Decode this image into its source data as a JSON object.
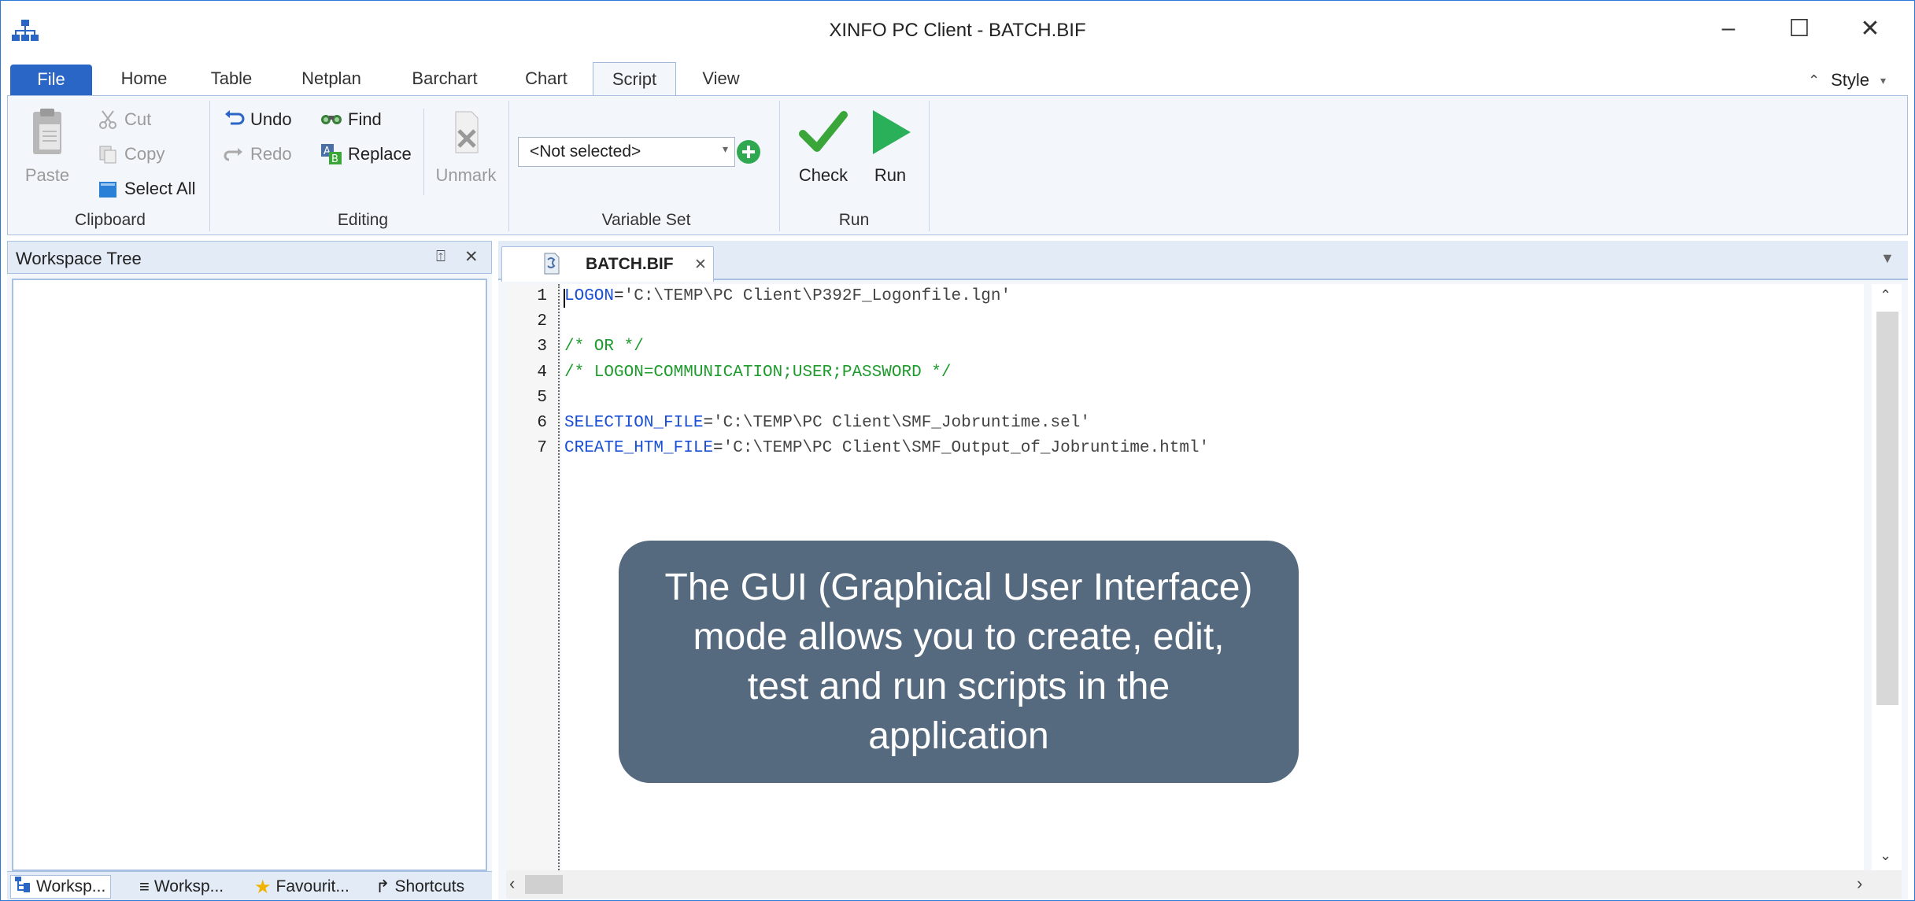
{
  "window": {
    "title": "XINFO PC Client - BATCH.BIF",
    "minimize_glyph": "–",
    "maximize_glyph": "☐",
    "close_glyph": "✕"
  },
  "ribbon_tabs": [
    "File",
    "Home",
    "Table",
    "Netplan",
    "Barchart",
    "Chart",
    "Script",
    "View"
  ],
  "active_tab": "Script",
  "style_menu": "Style",
  "ribbon": {
    "clipboard": {
      "label": "Clipboard",
      "paste": "Paste",
      "cut": "Cut",
      "copy": "Copy",
      "select_all": "Select All"
    },
    "editing": {
      "label": "Editing",
      "undo": "Undo",
      "redo": "Redo",
      "find": "Find",
      "replace": "Replace",
      "unmark": "Unmark"
    },
    "variable_set": {
      "label": "Variable Set",
      "selected": "<Not selected>"
    },
    "run": {
      "label": "Run",
      "check": "Check",
      "run": "Run"
    }
  },
  "workspace": {
    "title": "Workspace Tree",
    "pin_glyph": "⍐",
    "close_glyph": "✕",
    "bottom_tabs": [
      "Worksp...",
      "Worksp...",
      "Favourit...",
      "Shortcuts"
    ]
  },
  "editor": {
    "tab_label": "BATCH.BIF",
    "tab_close": "✕",
    "lines": [
      {
        "n": "1",
        "parts": [
          {
            "t": "kw",
            "s": "LOGON"
          },
          {
            "t": "op",
            "s": "="
          },
          {
            "t": "str",
            "s": "'C:\\TEMP\\PC Client\\P392F_Logonfile.lgn'"
          }
        ]
      },
      {
        "n": "2",
        "parts": []
      },
      {
        "n": "3",
        "parts": [
          {
            "t": "cmt",
            "s": "/* OR */"
          }
        ]
      },
      {
        "n": "4",
        "parts": [
          {
            "t": "cmt",
            "s": "/* LOGON=COMMUNICATION;USER;PASSWORD */"
          }
        ]
      },
      {
        "n": "5",
        "parts": []
      },
      {
        "n": "6",
        "parts": [
          {
            "t": "kw",
            "s": "SELECTION_FILE"
          },
          {
            "t": "op",
            "s": "="
          },
          {
            "t": "str",
            "s": "'C:\\TEMP\\PC Client\\SMF_Jobruntime.sel'"
          }
        ]
      },
      {
        "n": "7",
        "parts": [
          {
            "t": "kw",
            "s": "CREATE_HTM_FILE"
          },
          {
            "t": "op",
            "s": "="
          },
          {
            "t": "str",
            "s": "'C:\\TEMP\\PC Client\\SMF_Output_of_Jobruntime.html'"
          }
        ]
      }
    ]
  },
  "callout": {
    "text": "The GUI (Graphical User Interface) mode allows you to create, edit, test and run scripts in the application"
  },
  "colors": {
    "accent": "#2a66c6",
    "ribbon_bg": "#f3f6fb",
    "callout_bg": "#566a7f",
    "keyword": "#1a4fd6",
    "comment": "#1f9b2e",
    "check_green": "#3aa63a",
    "run_green": "#2bb05a"
  }
}
